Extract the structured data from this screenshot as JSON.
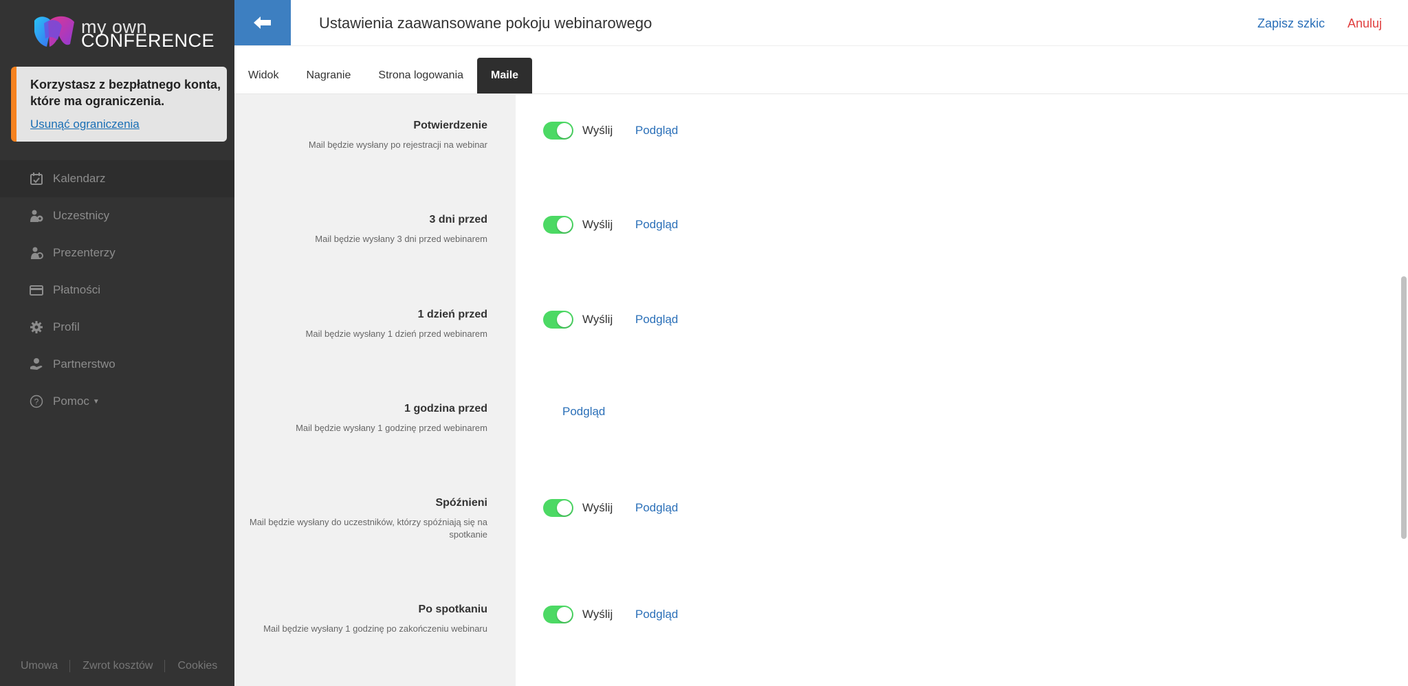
{
  "logo": {
    "line1": "my own",
    "line2": "CONFERENCE"
  },
  "notice": {
    "text": "Korzystasz z bezpłatnego konta, które ma ograniczenia.",
    "link": "Usunąć ograniczenia"
  },
  "nav": {
    "items": [
      {
        "label": "Kalendarz",
        "icon": "calendar-icon"
      },
      {
        "label": "Uczestnicy",
        "icon": "participants-icon"
      },
      {
        "label": "Prezenterzy",
        "icon": "presenters-icon"
      },
      {
        "label": "Płatności",
        "icon": "credit-card-icon"
      },
      {
        "label": "Profil",
        "icon": "gear-icon"
      },
      {
        "label": "Partnerstwo",
        "icon": "partnership-icon"
      },
      {
        "label": "Pomoc",
        "icon": "help-icon"
      }
    ]
  },
  "footer": {
    "links": [
      "Umowa",
      "Zwrot kosztów",
      "Cookies"
    ]
  },
  "header": {
    "title": "Ustawienia zaawansowane pokoju webinarowego",
    "save_draft": "Zapisz szkic",
    "cancel": "Anuluj"
  },
  "tabs": [
    "Widok",
    "Nagranie",
    "Strona logowania",
    "Maile"
  ],
  "active_tab": "Maile",
  "mails": [
    {
      "title": "Potwierdzenie",
      "desc": "Mail będzie wysłany po rejestracji na webinar",
      "enabled": true,
      "send_label": "Wyślij",
      "preview_label": "Podgląd"
    },
    {
      "title": "3 dni przed",
      "desc": "Mail będzie wysłany 3 dni przed webinarem",
      "enabled": true,
      "send_label": "Wyślij",
      "preview_label": "Podgląd"
    },
    {
      "title": "1 dzień przed",
      "desc": "Mail będzie wysłany 1 dzień przed webinarem",
      "enabled": true,
      "send_label": "Wyślij",
      "preview_label": "Podgląd"
    },
    {
      "title": "1 godzina przed",
      "desc": "Mail będzie wysłany 1 godzinę przed webinarem",
      "enabled": false,
      "send_label": "",
      "preview_label": "Podgląd"
    },
    {
      "title": "Spóźnieni",
      "desc": "Mail będzie wysłany do uczestników, którzy spóźniają się na spotkanie",
      "enabled": true,
      "send_label": "Wyślij",
      "preview_label": "Podgląd"
    },
    {
      "title": "Po spotkaniu",
      "desc": "Mail będzie wysłany 1 godzinę po zakończeniu webinaru",
      "enabled": true,
      "send_label": "Wyślij",
      "preview_label": "Podgląd"
    }
  ],
  "colors": {
    "accent": "#3d7fc1",
    "toggle_on": "#4cd964",
    "warning": "#f5821f",
    "danger": "#e03e3e",
    "sidebar": "#333333"
  }
}
